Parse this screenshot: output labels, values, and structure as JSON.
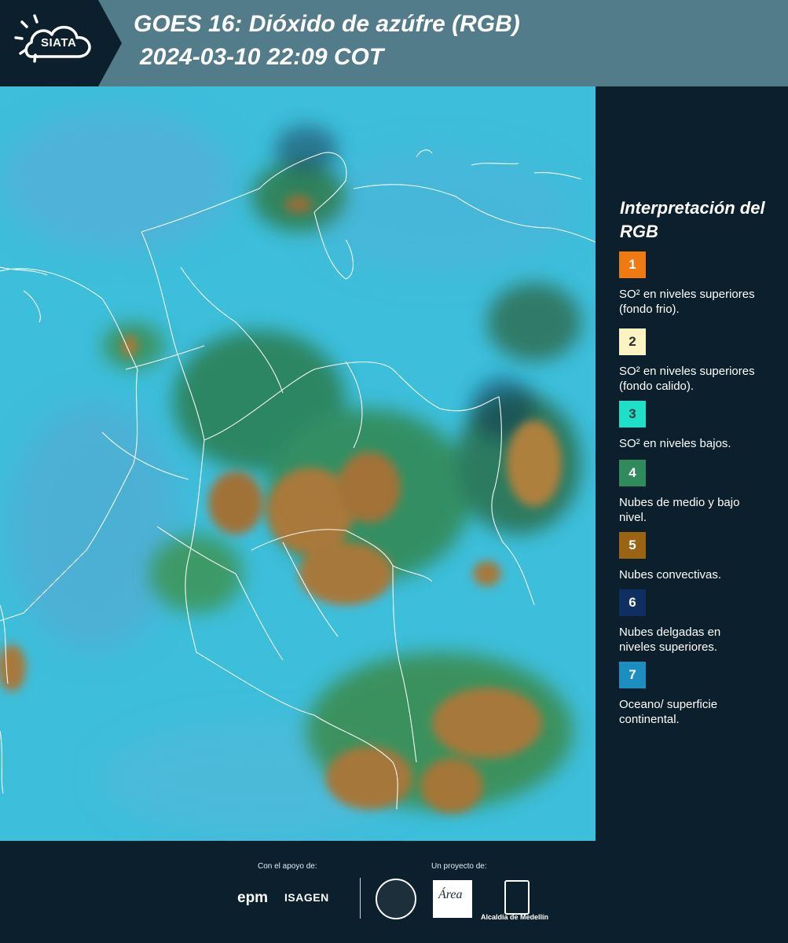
{
  "header": {
    "logo_text": "SIATA",
    "title_line1": "GOES 16: Dióxido de azúfre (RGB)",
    "title_line2": "2024-03-10 22:09 COT"
  },
  "map": {
    "description_icon": "satellite-rgb-map"
  },
  "legend": {
    "title": "Interpretación del RGB",
    "items": [
      {
        "number": "1",
        "color": "#f07a12",
        "label": "SO² en niveles superiores (fondo frio)."
      },
      {
        "number": "2",
        "color": "#fbf3c2",
        "label": "SO² en niveles superiores (fondo calido)."
      },
      {
        "number": "3",
        "color": "#1ee0c6",
        "label": "SO² en niveles bajos."
      },
      {
        "number": "4",
        "color": "#2f8a5c",
        "label": "Nubes de medio y bajo nivel."
      },
      {
        "number": "5",
        "color": "#9a6413",
        "label": "Nubes convectivas."
      },
      {
        "number": "6",
        "color": "#0f2f63",
        "label": "Nubes delgadas en niveles superiores."
      },
      {
        "number": "7",
        "color": "#1a8fc0",
        "label": "Oceano/ superficie continental."
      }
    ]
  },
  "footer": {
    "support_caption": "Con el apoyo de:",
    "project_caption": "Un proyecto de:",
    "epm": "epm",
    "isagen": "ISAGEN",
    "area_logo_text": "Área",
    "alcaldia": "Alcaldía de Medellín"
  }
}
